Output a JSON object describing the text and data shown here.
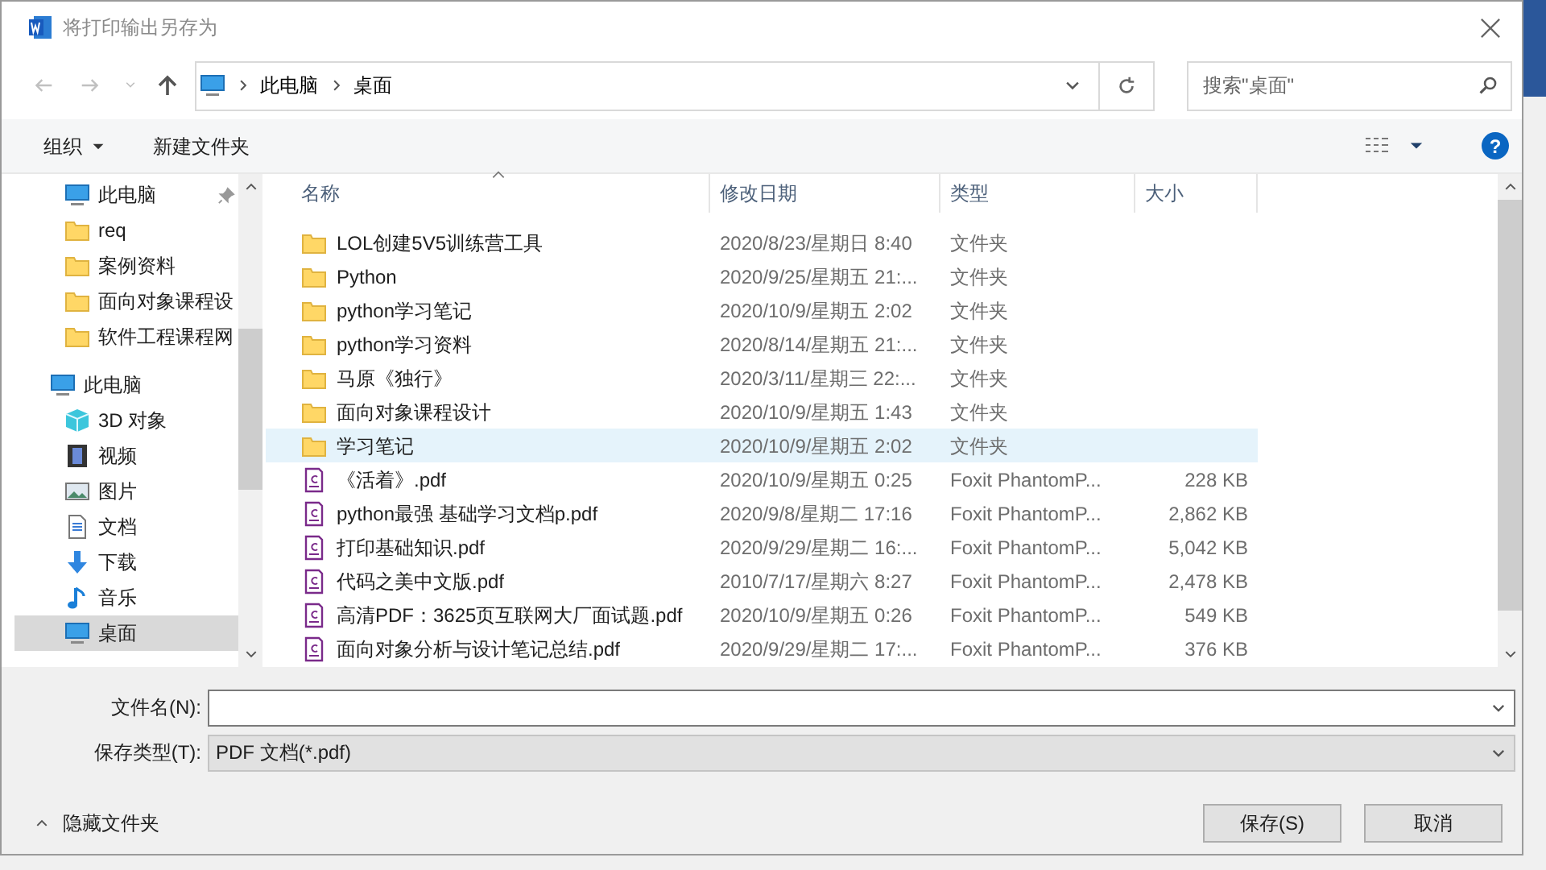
{
  "window": {
    "title": "将打印输出另存为"
  },
  "address": {
    "crumbs": [
      "此电脑",
      "桌面"
    ]
  },
  "search": {
    "placeholder": "搜索\"桌面\""
  },
  "toolbar": {
    "organize": "组织",
    "new_folder": "新建文件夹",
    "help": "?"
  },
  "sidebar": {
    "items": [
      {
        "label": "此电脑",
        "kind": "pc",
        "pinned": true,
        "selected": false
      },
      {
        "label": "req",
        "kind": "folder",
        "pinned": false,
        "selected": false
      },
      {
        "label": "案例资料",
        "kind": "folder",
        "pinned": false,
        "selected": false
      },
      {
        "label": "面向对象课程设",
        "kind": "folder",
        "pinned": false,
        "selected": false
      },
      {
        "label": "软件工程课程网",
        "kind": "folder",
        "pinned": false,
        "selected": false
      },
      {
        "label": "此电脑",
        "kind": "pc",
        "pinned": false,
        "selected": false,
        "children": [
          {
            "label": "3D 对象",
            "kind": "cube",
            "pinned": false,
            "selected": false
          },
          {
            "label": "视频",
            "kind": "video",
            "pinned": false,
            "selected": false
          },
          {
            "label": "图片",
            "kind": "picture",
            "pinned": false,
            "selected": false
          },
          {
            "label": "文档",
            "kind": "document",
            "pinned": false,
            "selected": false
          },
          {
            "label": "下载",
            "kind": "download",
            "pinned": false,
            "selected": false
          },
          {
            "label": "音乐",
            "kind": "music",
            "pinned": false,
            "selected": false
          },
          {
            "label": "桌面",
            "kind": "desktop",
            "pinned": false,
            "selected": true
          }
        ]
      }
    ]
  },
  "table": {
    "columns": [
      "名称",
      "修改日期",
      "类型",
      "大小"
    ],
    "rows": [
      {
        "kind": "folder",
        "name": "LOL创建5V5训练营工具",
        "date": "2020/8/23/星期日 8:40",
        "type": "文件夹",
        "selected": false
      },
      {
        "kind": "folder",
        "name": "Python",
        "date": "2020/9/25/星期五 21:...",
        "type": "文件夹",
        "selected": false
      },
      {
        "kind": "folder",
        "name": "python学习笔记",
        "date": "2020/10/9/星期五 2:02",
        "type": "文件夹",
        "selected": false
      },
      {
        "kind": "folder",
        "name": "python学习资料",
        "date": "2020/8/14/星期五 21:...",
        "type": "文件夹",
        "selected": false
      },
      {
        "kind": "folder",
        "name": "马原《独行》",
        "date": "2020/3/11/星期三 22:...",
        "type": "文件夹",
        "selected": false
      },
      {
        "kind": "folder",
        "name": "面向对象课程设计",
        "date": "2020/10/9/星期五 1:43",
        "type": "文件夹",
        "selected": false
      },
      {
        "kind": "folder",
        "name": "学习笔记",
        "date": "2020/10/9/星期五 2:02",
        "type": "文件夹",
        "selected": true
      },
      {
        "kind": "pdf",
        "name": "《活着》.pdf",
        "date": "2020/10/9/星期五 0:25",
        "type": "Foxit PhantomP...",
        "size": "228 KB",
        "selected": false
      },
      {
        "kind": "pdf",
        "name": "python最强 基础学习文档p.pdf",
        "date": "2020/9/8/星期二 17:16",
        "type": "Foxit PhantomP...",
        "size": "2,862 KB",
        "selected": false
      },
      {
        "kind": "pdf",
        "name": "打印基础知识.pdf",
        "date": "2020/9/29/星期二 16:...",
        "type": "Foxit PhantomP...",
        "size": "5,042 KB",
        "selected": false
      },
      {
        "kind": "pdf",
        "name": "代码之美中文版.pdf",
        "date": "2010/7/17/星期六 8:27",
        "type": "Foxit PhantomP...",
        "size": "2,478 KB",
        "selected": false
      },
      {
        "kind": "pdf",
        "name": "高清PDF：3625页互联网大厂面试题.pdf",
        "date": "2020/10/9/星期五 0:26",
        "type": "Foxit PhantomP...",
        "size": "549 KB",
        "selected": false
      },
      {
        "kind": "pdf",
        "name": "面向对象分析与设计笔记总结.pdf",
        "date": "2020/9/29/星期二 17:...",
        "type": "Foxit PhantomP...",
        "size": "376 KB",
        "selected": false
      }
    ]
  },
  "filename": {
    "label": "文件名(N):"
  },
  "filetype": {
    "label": "保存类型(T):",
    "value": "PDF 文档(*.pdf)"
  },
  "hide_folders": "隐藏文件夹",
  "buttons": [
    "保存(S)",
    "取消"
  ]
}
